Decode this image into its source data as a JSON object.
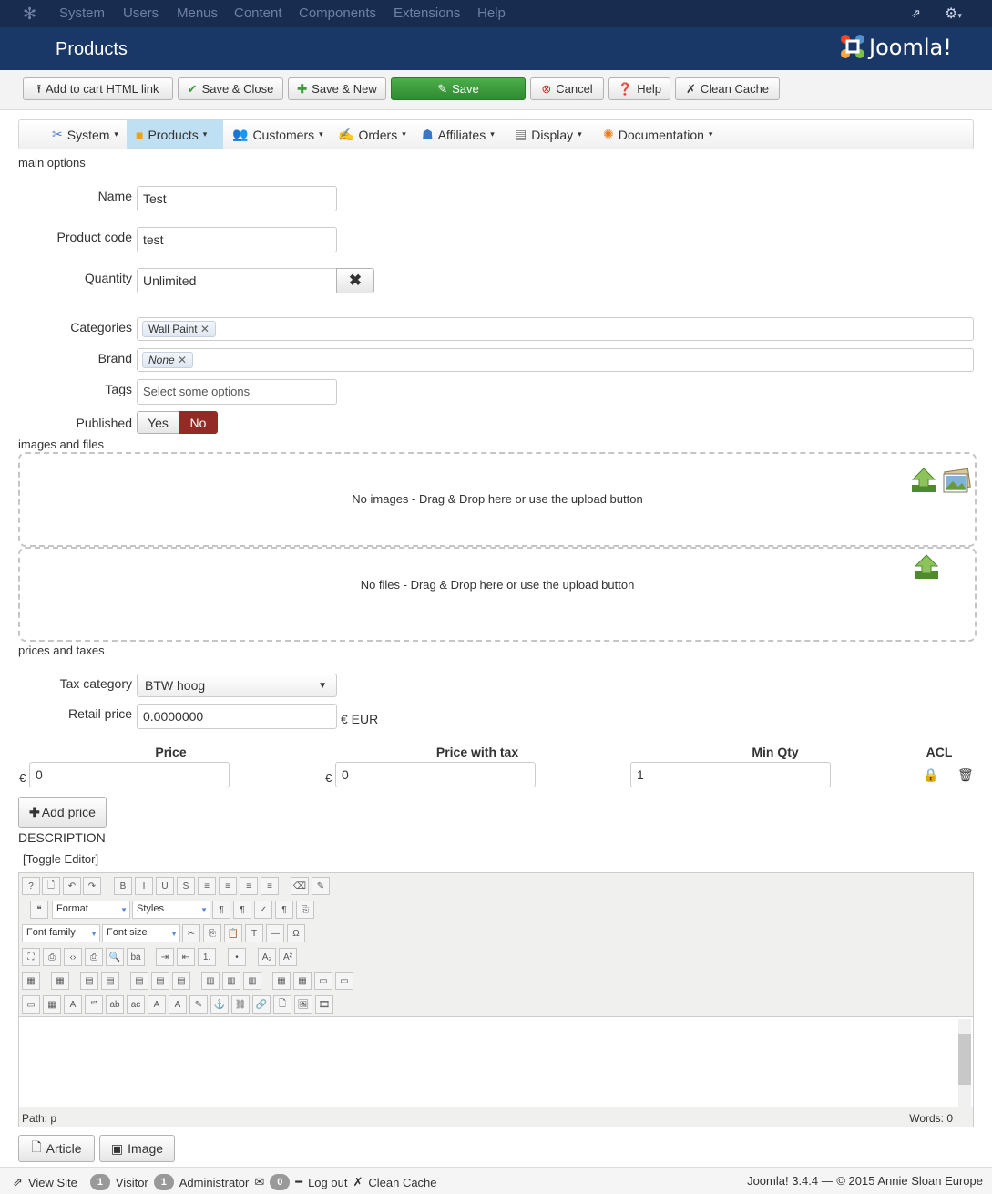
{
  "topnav": {
    "items": [
      "System",
      "Users",
      "Menus",
      "Content",
      "Components",
      "Extensions",
      "Help"
    ]
  },
  "header": {
    "title": "Products",
    "logo_text": "Joomla!"
  },
  "toolbar": {
    "add_cart": "Add to cart HTML link",
    "save_close": "Save & Close",
    "save_new": "Save & New",
    "save": "Save",
    "cancel": "Cancel",
    "help": "Help",
    "clean_cache": "Clean Cache"
  },
  "submenu": [
    "System",
    "Products",
    "Customers",
    "Orders",
    "Affiliates",
    "Display",
    "Documentation"
  ],
  "sections": {
    "main": "main options",
    "images": "images and files",
    "prices": "prices and taxes",
    "description": "DESCRIPTION"
  },
  "form": {
    "name_label": "Name",
    "name_value": "Test",
    "code_label": "Product code",
    "code_value": "test",
    "qty_label": "Quantity",
    "qty_value": "Unlimited",
    "categories_label": "Categories",
    "categories_tag": "Wall Paint",
    "brand_label": "Brand",
    "brand_tag": "None",
    "tags_label": "Tags",
    "tags_placeholder": "Select some options",
    "published_label": "Published",
    "yes": "Yes",
    "no": "No"
  },
  "files": {
    "images_msg": "No images - Drag & Drop here or use the upload button",
    "files_msg": "No files - Drag & Drop here or use the upload button"
  },
  "prices": {
    "tax_label": "Tax category",
    "tax_value": "BTW hoog",
    "retail_label": "Retail price",
    "retail_value": "0.0000000",
    "currency": "€ EUR",
    "col_price": "Price",
    "col_price_tax": "Price with tax",
    "col_min_qty": "Min Qty",
    "col_acl": "ACL",
    "euro": "€",
    "price_value": "0",
    "price_tax_value": "0",
    "min_qty_value": "1",
    "add_price": "Add price"
  },
  "editor": {
    "toggle": "[Toggle Editor]",
    "format": "Format",
    "styles": "Styles",
    "font_family": "Font family",
    "font_size": "Font size",
    "path": "Path:",
    "path_value": "p",
    "words": "Words: 0"
  },
  "editor_buttons": {
    "article": "Article",
    "image": "Image"
  },
  "statusbar": {
    "view_site": "View Site",
    "visitor_count": "1",
    "visitor": "Visitor",
    "admin_count": "1",
    "admin": "Administrator",
    "msg_count": "0",
    "logout": "Log out",
    "clean_cache": "Clean Cache",
    "copyright": "Joomla! 3.4.4 — © 2015 Annie Sloan Europe"
  }
}
